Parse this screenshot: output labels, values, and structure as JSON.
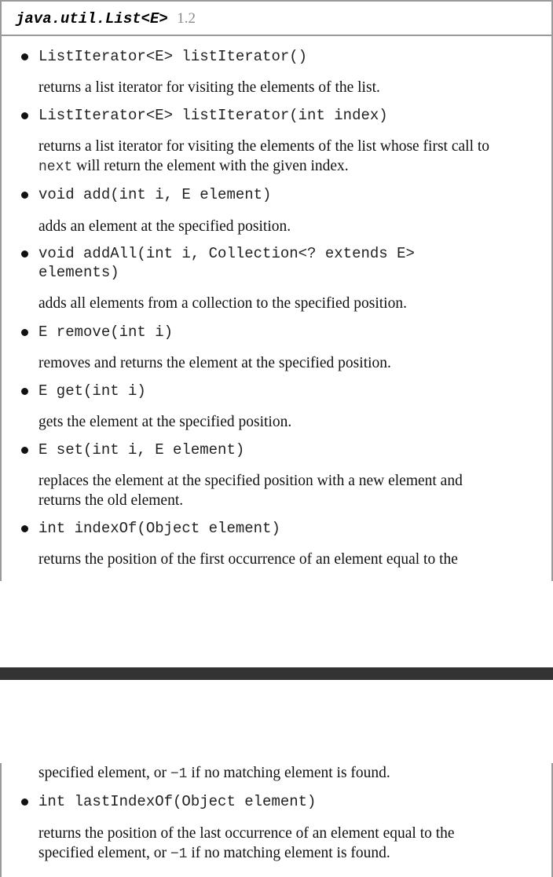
{
  "header": {
    "class_name": "java.util.List<E>",
    "version": "1.2"
  },
  "methods": [
    {
      "signature": "ListIterator<E> listIterator()",
      "description": "returns a list iterator for visiting the elements of the list."
    },
    {
      "signature": "ListIterator<E> listIterator(int index)",
      "description_before": "returns a list iterator for visiting the elements of the list whose first call to",
      "description_code": "next",
      "description_after": " will return the element with the given index."
    },
    {
      "signature": "void add(int i, E element)",
      "description": "adds an element at the specified position."
    },
    {
      "signature_line1": "void addAll(int i, Collection<? extends E>",
      "signature_line2": "elements)",
      "description": "adds all elements from a collection to the specified position."
    },
    {
      "signature": "E remove(int i)",
      "description": "removes and returns the element at the specified position."
    },
    {
      "signature": "E get(int i)",
      "description": "gets the element at the specified position."
    },
    {
      "signature": "E set(int i, E element)",
      "description_line1": "replaces the element at the specified position with a new element and",
      "description_line2": "returns the old element."
    },
    {
      "signature": "int indexOf(Object element)",
      "description_part1": "returns the position of the first occurrence of an element equal to the",
      "description_part2_before": "specified element, or ",
      "description_part2_code": "−1",
      "description_part2_after": " if no matching element is found."
    },
    {
      "signature": "int lastIndexOf(Object element)",
      "description_line1": "returns the position of the last occurrence of an element equal to the",
      "description_line2_before": "specified element, or ",
      "description_line2_code": "−1",
      "description_line2_after": " if no matching element is found."
    }
  ]
}
